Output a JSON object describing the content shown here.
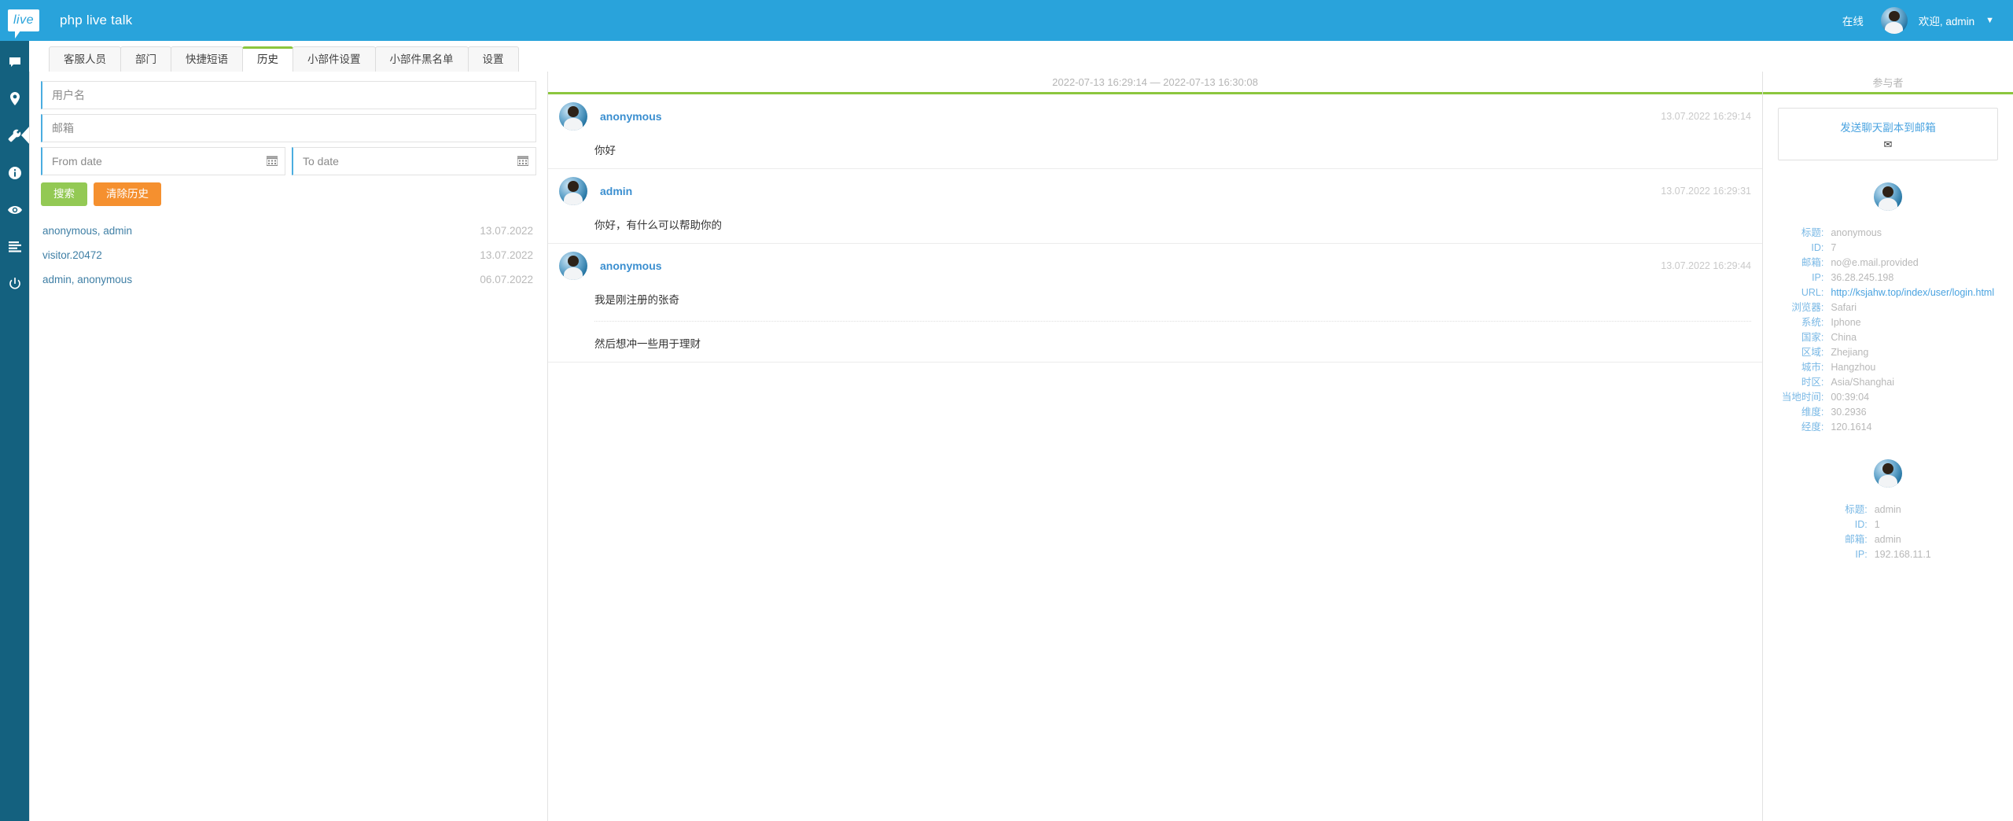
{
  "header": {
    "logo_text": "live",
    "app_title": "php live talk",
    "status": "在线",
    "welcome": "欢迎, admin",
    "caret": "▼",
    "bg_color": "#29a3db"
  },
  "rail": {
    "items": [
      {
        "name": "chat-icon",
        "label": "聊天"
      },
      {
        "name": "location-icon",
        "label": "访客"
      },
      {
        "name": "wrench-icon",
        "label": "设置",
        "active": true
      },
      {
        "name": "info-icon",
        "label": "信息"
      },
      {
        "name": "eye-icon",
        "label": "监视"
      },
      {
        "name": "list-icon",
        "label": "报表"
      },
      {
        "name": "power-icon",
        "label": "退出"
      }
    ]
  },
  "tabs": [
    {
      "label": "客服人员",
      "active": false
    },
    {
      "label": "部门",
      "active": false
    },
    {
      "label": "快捷短语",
      "active": false
    },
    {
      "label": "历史",
      "active": true
    },
    {
      "label": "小部件设置",
      "active": false
    },
    {
      "label": "小部件黑名单",
      "active": false
    },
    {
      "label": "设置",
      "active": false
    }
  ],
  "search": {
    "username_value": "",
    "username_placeholder": "用户名",
    "email_value": "",
    "email_placeholder": "邮箱",
    "from_date_value": "",
    "from_date_placeholder": "From date",
    "to_date_value": "",
    "to_date_placeholder": "To date",
    "search_button": "搜索",
    "clear_button": "清除历史",
    "search_color": "#93c954",
    "clear_color": "#f5902f"
  },
  "history": {
    "rows": [
      {
        "name": "anonymous, admin",
        "date": "13.07.2022"
      },
      {
        "name": "visitor.20472",
        "date": "13.07.2022"
      },
      {
        "name": "admin, anonymous",
        "date": "06.07.2022"
      }
    ]
  },
  "chat": {
    "header_range": "2022-07-13 16:29:14 — 2022-07-13 16:30:08",
    "accent_color": "#8cc63e",
    "messages": [
      {
        "author": "anonymous",
        "time": "13.07.2022 16:29:14",
        "lines": [
          "你好"
        ]
      },
      {
        "author": "admin",
        "time": "13.07.2022 16:29:31",
        "lines": [
          "你好，有什么可以帮助你的"
        ]
      },
      {
        "author": "anonymous",
        "time": "13.07.2022 16:29:44",
        "lines": [
          "我是刚注册的张奇",
          "然后想冲一些用于理财"
        ]
      }
    ]
  },
  "participants_panel": {
    "title": "参与者",
    "mail_link": "发送聊天副本到邮箱",
    "mail_icon": "✉",
    "people": [
      {
        "fields": [
          {
            "key": "标题:",
            "value": "anonymous",
            "link": false
          },
          {
            "key": "ID:",
            "value": "7",
            "link": false
          },
          {
            "key": "邮箱:",
            "value": "no@e.mail.provided",
            "link": false
          },
          {
            "key": "IP:",
            "value": "36.28.245.198",
            "link": false
          },
          {
            "key": "URL:",
            "value": "http://ksjahw.top/index/user/login.html",
            "link": true
          },
          {
            "key": "浏览器:",
            "value": "Safari",
            "link": false
          },
          {
            "key": "系统:",
            "value": "Iphone",
            "link": false
          },
          {
            "key": "国家:",
            "value": "China",
            "link": false
          },
          {
            "key": "区域:",
            "value": "Zhejiang",
            "link": false
          },
          {
            "key": "城市:",
            "value": "Hangzhou",
            "link": false
          },
          {
            "key": "时区:",
            "value": "Asia/Shanghai",
            "link": false
          },
          {
            "key": "当地时间:",
            "value": "00:39:04",
            "link": false
          },
          {
            "key": "维度:",
            "value": "30.2936",
            "link": false
          },
          {
            "key": "经度:",
            "value": "120.1614",
            "link": false
          }
        ]
      },
      {
        "fields": [
          {
            "key": "标题:",
            "value": "admin",
            "link": false
          },
          {
            "key": "ID:",
            "value": "1",
            "link": false
          },
          {
            "key": "邮箱:",
            "value": "admin",
            "link": false
          },
          {
            "key": "IP:",
            "value": "192.168.11.1",
            "link": false
          }
        ]
      }
    ]
  }
}
